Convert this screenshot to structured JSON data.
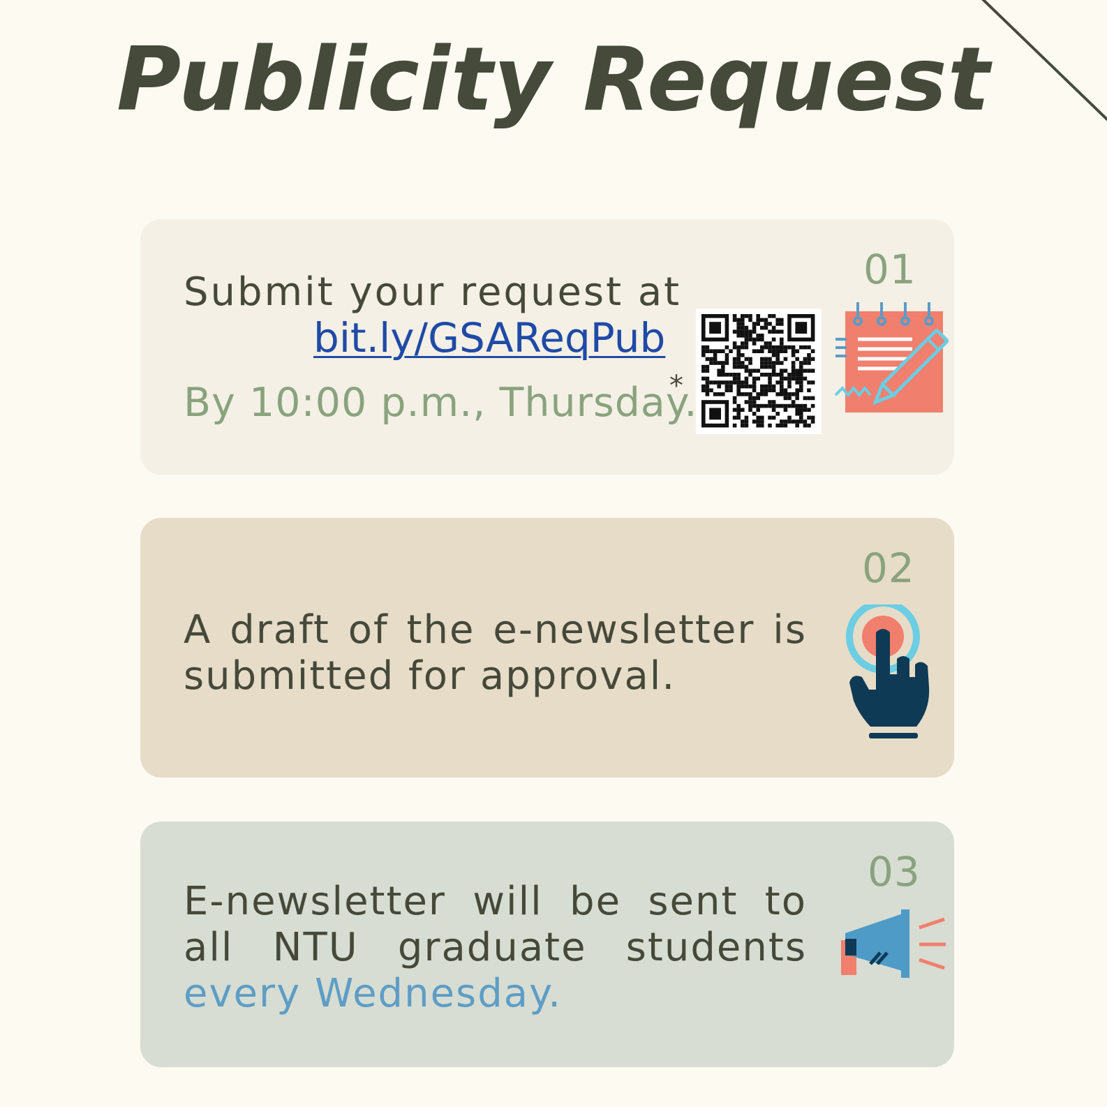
{
  "page": {
    "title": "Publicity Request"
  },
  "steps": [
    {
      "number": "01",
      "line1": "Submit your request at",
      "link": "bit.ly/GSAReqPub",
      "deadline": "By 10:00 p.m., Thursday.",
      "asterisk": "*",
      "icon": "notepad-pencil-icon",
      "qr_code": "qr-code"
    },
    {
      "number": "02",
      "text": "A draft of the e-newsletter is submitted for approval.",
      "icon": "tap-hand-icon"
    },
    {
      "number": "03",
      "text_before": "E-newsletter will be sent to all NTU graduate students ",
      "text_highlight": "every Wednesday.",
      "icon": "megaphone-icon"
    }
  ],
  "colors": {
    "background": "#fdfaf2",
    "title": "#454a3a",
    "text": "#46493a",
    "step_number": "#8aa37f",
    "link": "#1f4aa6",
    "highlight": "#5e9dc6",
    "card_1": "#f4f0e5",
    "card_2": "#e6dcc8",
    "card_3": "#d7ddd2"
  }
}
